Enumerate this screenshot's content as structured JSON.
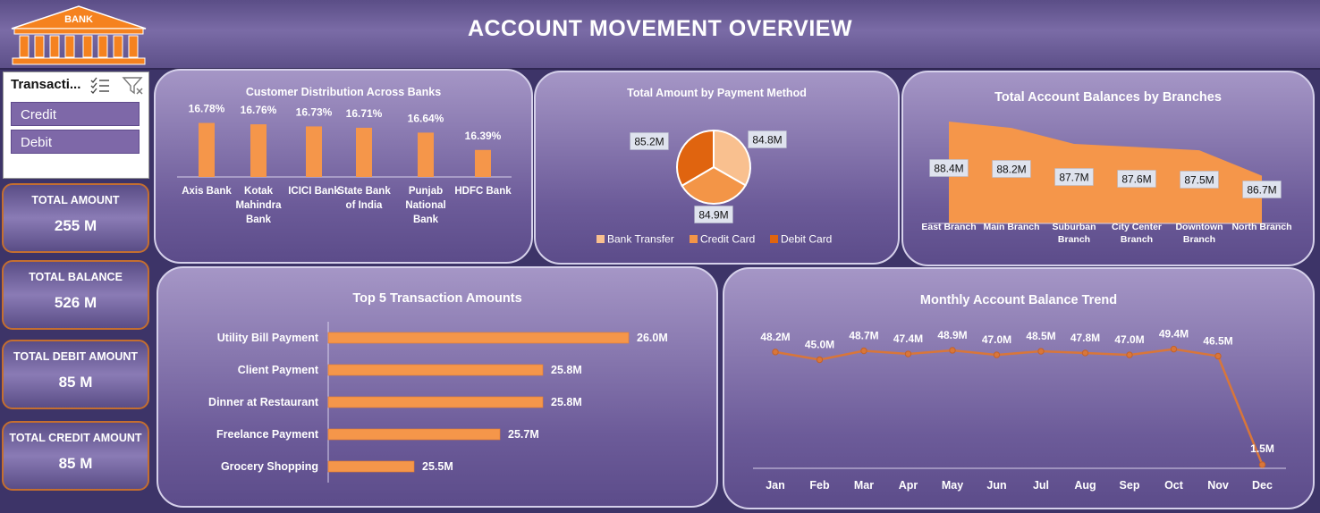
{
  "header": {
    "title": "ACCOUNT MOVEMENT OVERVIEW",
    "logo_text": "BANK"
  },
  "slicer": {
    "title": "Transacti...",
    "items": [
      "Credit",
      "Debit"
    ]
  },
  "kpis": [
    {
      "label": "TOTAL AMOUNT",
      "value": "255 M"
    },
    {
      "label": "TOTAL BALANCE",
      "value": "526 M"
    },
    {
      "label": "TOTAL DEBIT AMOUNT",
      "value": "85 M"
    },
    {
      "label": "TOTAL CREDIT AMOUNT",
      "value": "85 M"
    }
  ],
  "colors": {
    "accent": "#f5964a",
    "pie_bank_transfer": "#f9c08f",
    "pie_credit_card": "#f39547",
    "pie_debit_card": "#e0640f",
    "line": "#d8763a"
  },
  "chart_data": [
    {
      "type": "bar",
      "title": "Customer Distribution Across Banks",
      "categories": [
        "Axis Bank",
        "Kotak Mahindra Bank",
        "ICICI Bank",
        "State Bank of India",
        "Punjab National Bank",
        "HDFC Bank"
      ],
      "category_lines": [
        [
          "Axis Bank"
        ],
        [
          "Kotak",
          "Mahindra",
          "Bank"
        ],
        [
          "ICICI Bank"
        ],
        [
          "State Bank",
          "of India"
        ],
        [
          "Punjab",
          "National",
          "Bank"
        ],
        [
          "HDFC Bank"
        ]
      ],
      "values": [
        16.78,
        16.76,
        16.73,
        16.71,
        16.64,
        16.39
      ],
      "labels": [
        "16.78%",
        "16.76%",
        "16.73%",
        "16.71%",
        "16.64%",
        "16.39%"
      ],
      "ylim": [
        16.0,
        16.8
      ]
    },
    {
      "type": "pie",
      "title": "Total Amount by Payment Method",
      "categories": [
        "Bank Transfer",
        "Credit Card",
        "Debit Card"
      ],
      "values": [
        84.8,
        84.9,
        85.2
      ],
      "labels": [
        "84.8M",
        "84.9M",
        "85.2M"
      ]
    },
    {
      "type": "area",
      "title": "Total Account Balances by Branches",
      "categories": [
        "East Branch",
        "Main Branch",
        "Suburban Branch",
        "City Center Branch",
        "Downtown Branch",
        "North Branch"
      ],
      "category_lines": [
        [
          "East Branch"
        ],
        [
          "Main Branch"
        ],
        [
          "Suburban",
          "Branch"
        ],
        [
          "City Center",
          "Branch"
        ],
        [
          "Downtown",
          "Branch"
        ],
        [
          "North Branch"
        ]
      ],
      "values": [
        88.4,
        88.2,
        87.7,
        87.6,
        87.5,
        86.7
      ],
      "labels": [
        "88.4M",
        "88.2M",
        "87.7M",
        "87.6M",
        "87.5M",
        "86.7M"
      ],
      "ylim": [
        85.2,
        88.4
      ]
    },
    {
      "type": "bar",
      "orientation": "horizontal",
      "title": "Top 5 Transaction Amounts",
      "categories": [
        "Utility Bill Payment",
        "Client Payment",
        "Dinner at Restaurant",
        "Freelance Payment",
        "Grocery Shopping"
      ],
      "values": [
        26.0,
        25.8,
        25.8,
        25.7,
        25.5
      ],
      "labels": [
        "26.0M",
        "25.8M",
        "25.8M",
        "25.7M",
        "25.5M"
      ],
      "xlim": [
        25.3,
        26.0
      ]
    },
    {
      "type": "line",
      "title": "Monthly Account Balance Trend",
      "categories": [
        "Jan",
        "Feb",
        "Mar",
        "Apr",
        "May",
        "Jun",
        "Jul",
        "Aug",
        "Sep",
        "Oct",
        "Nov",
        "Dec"
      ],
      "values": [
        48.2,
        45.0,
        48.7,
        47.4,
        48.9,
        47.0,
        48.5,
        47.8,
        47.0,
        49.4,
        46.5,
        1.5
      ],
      "labels": [
        "48.2M",
        "45.0M",
        "48.7M",
        "47.4M",
        "48.9M",
        "47.0M",
        "48.5M",
        "47.8M",
        "47.0M",
        "49.4M",
        "46.5M",
        "1.5M"
      ],
      "ylim": [
        0,
        55
      ]
    }
  ]
}
